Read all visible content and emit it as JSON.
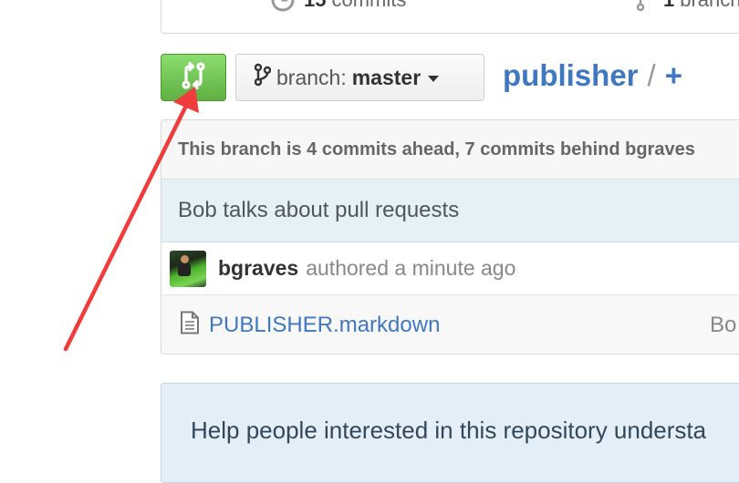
{
  "stats": {
    "commits_count": "15",
    "commits_label": "commits",
    "branches_count": "1",
    "branches_label": "branch"
  },
  "toolbar": {
    "compare_icon": "compare-arrows-icon",
    "branch_icon": "git-branch-icon",
    "branch_label": "branch:",
    "branch_value": "master"
  },
  "repo": {
    "name": "publisher",
    "separator": "/",
    "add_file": "+"
  },
  "commit_box": {
    "tracking_text": "This branch is 4 commits ahead, 7 commits behind bgraves",
    "commit_title": "Bob talks about pull requests",
    "author": "bgraves",
    "authored_text": "authored a minute ago",
    "file_name": "PUBLISHER.markdown",
    "file_message": "Bo"
  },
  "readme": {
    "prompt_text": "Help people interested in this repository understa"
  },
  "colors": {
    "accent": "#4078c0",
    "compare_green": "#60b044",
    "annotation_red": "#f03c3c",
    "commit_bg": "#e6f1f6"
  }
}
